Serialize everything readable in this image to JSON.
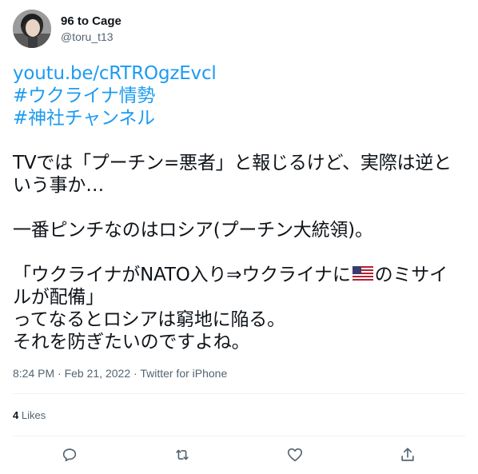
{
  "author": {
    "display_name": "96 to Cage",
    "handle": "@toru_t13",
    "avatar_icon": "user-avatar-photo"
  },
  "tweet": {
    "link": "youtu.be/cRTROgzEvcl",
    "hashtags": [
      "#ウクライナ情勢",
      "#神社チャンネル"
    ],
    "lines": {
      "l1": "TVでは「プーチン=悪者」と報じるけど、実際は逆と",
      "l2": "いう事か…",
      "l3": "一番ピンチなのはロシア(プーチン大統領)。",
      "l4_before_flag": "「ウクライナがNATO入り⇒ウクライナに",
      "l4_after_flag": "のミサイ",
      "l5": "ルが配備」",
      "l6": "ってなるとロシアは窮地に陥る。",
      "l7": "それを防ぎたいのですよね。"
    },
    "flag_icon": "us-flag-icon"
  },
  "meta": {
    "time": "8:24 PM",
    "separator": " · ",
    "date": "Feb 21, 2022",
    "source": "Twitter for iPhone"
  },
  "stats": {
    "likes_count": "4",
    "likes_label": " Likes"
  },
  "actions": {
    "reply_icon": "reply-icon",
    "retweet_icon": "retweet-icon",
    "like_icon": "heart-icon",
    "share_icon": "share-icon"
  },
  "colors": {
    "link": "#1d9bf0",
    "secondary_text": "#536471",
    "divider": "#eff3f4"
  }
}
